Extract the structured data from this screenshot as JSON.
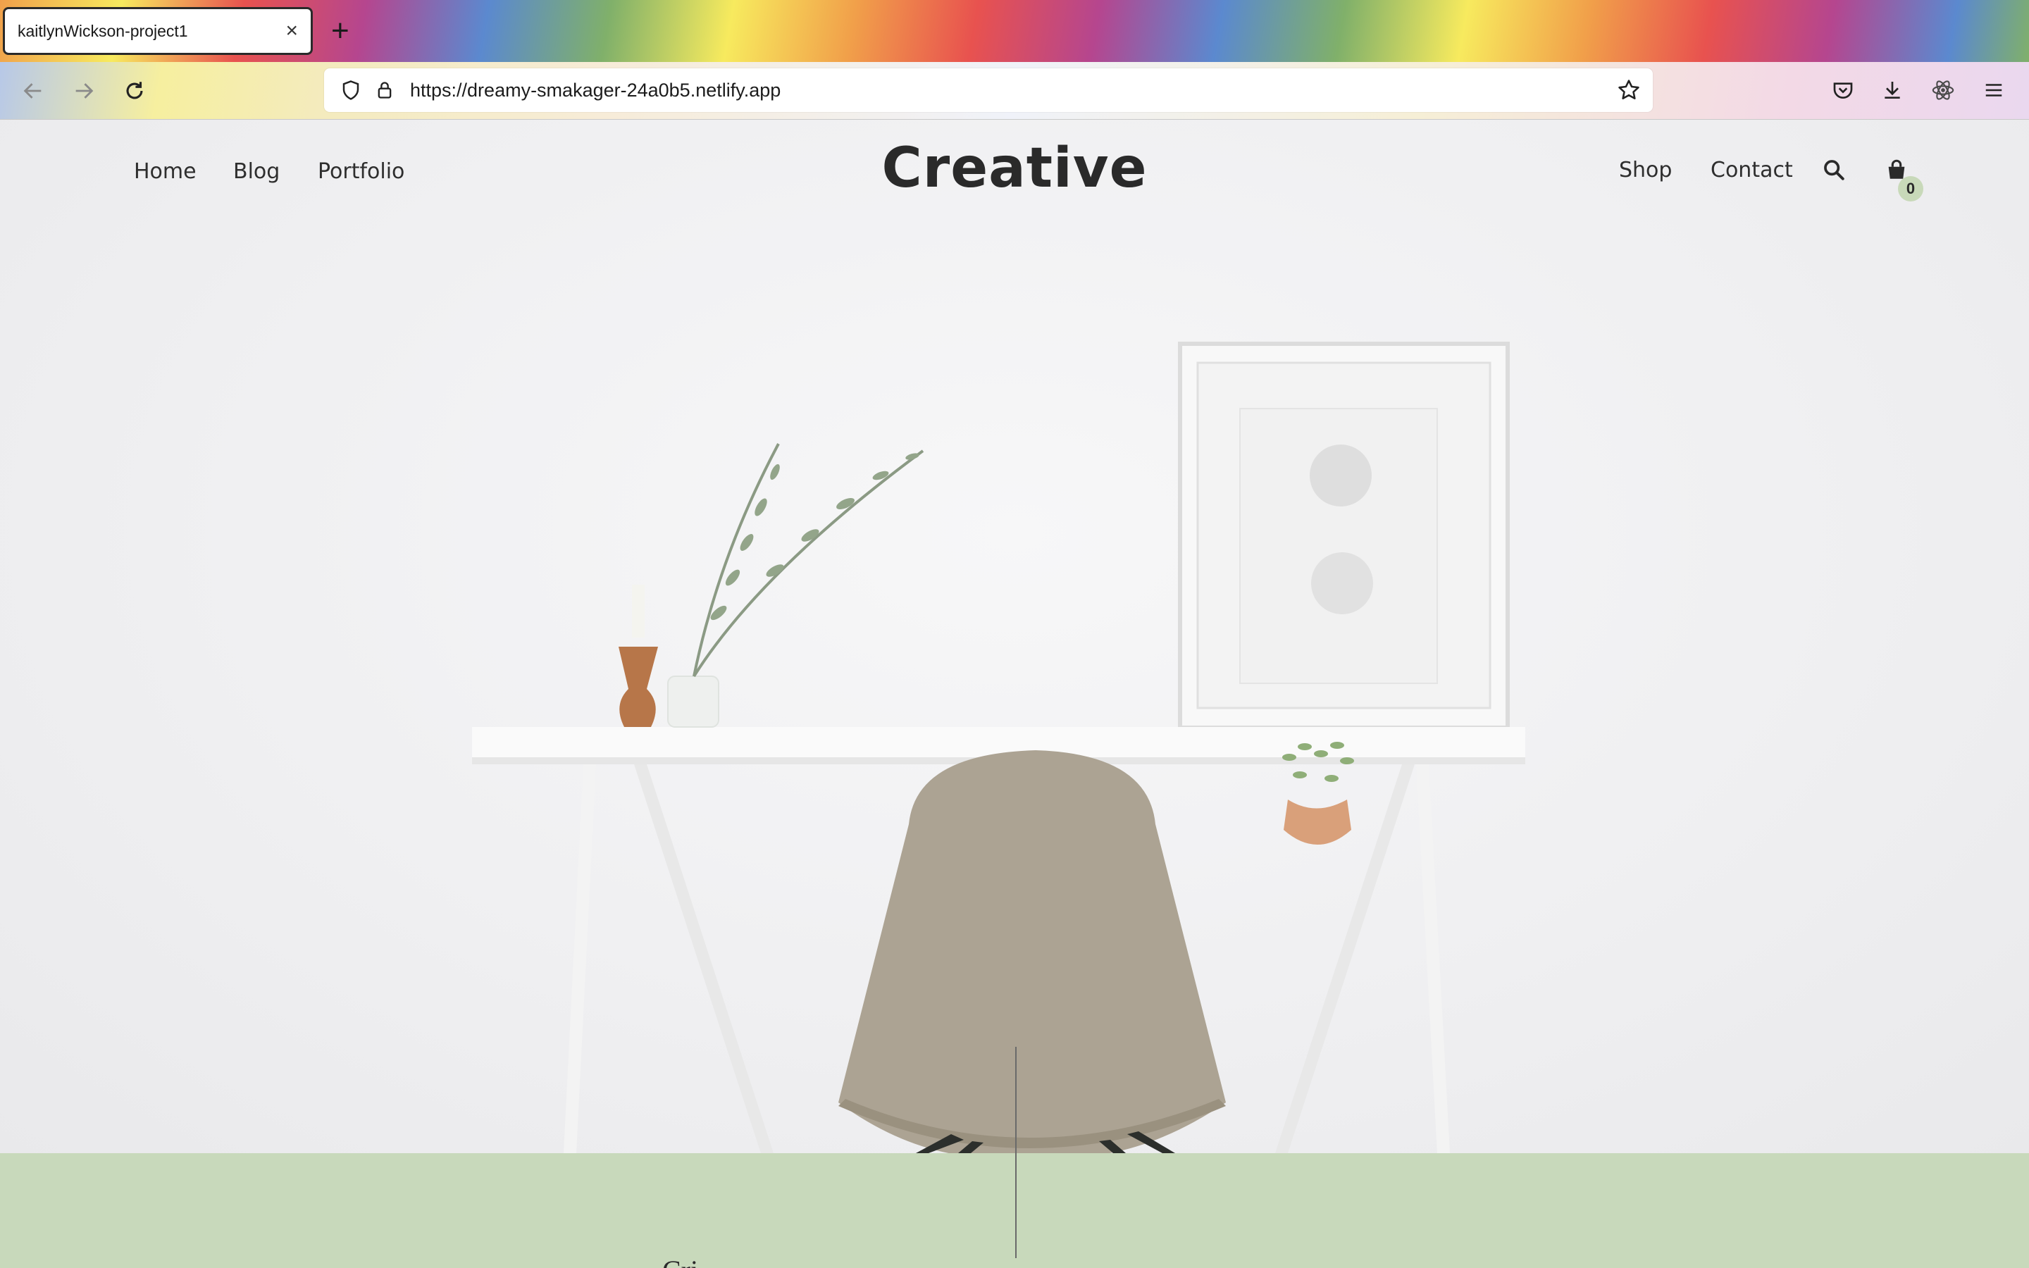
{
  "browser": {
    "tab": {
      "title": "kaitlynWickson-project1",
      "close_icon": "close-icon"
    },
    "new_tab_label": "+",
    "url": "https://dreamy-smakager-24a0b5.netlify.app",
    "toolbar_icons": [
      "back-icon",
      "forward-icon",
      "reload-icon",
      "shield-icon",
      "lock-icon",
      "star-icon",
      "pocket-icon",
      "download-icon",
      "react-devtools-icon",
      "menu-icon"
    ]
  },
  "site": {
    "brand": "Creative",
    "nav_left": [
      "Home",
      "Blog",
      "Portfolio"
    ],
    "nav_right": [
      "Shop",
      "Contact"
    ],
    "cart_count": "0",
    "section_peek_text": "Cri"
  },
  "colors": {
    "accent_green": "#c8d9bb",
    "text": "#2e2e2e"
  }
}
